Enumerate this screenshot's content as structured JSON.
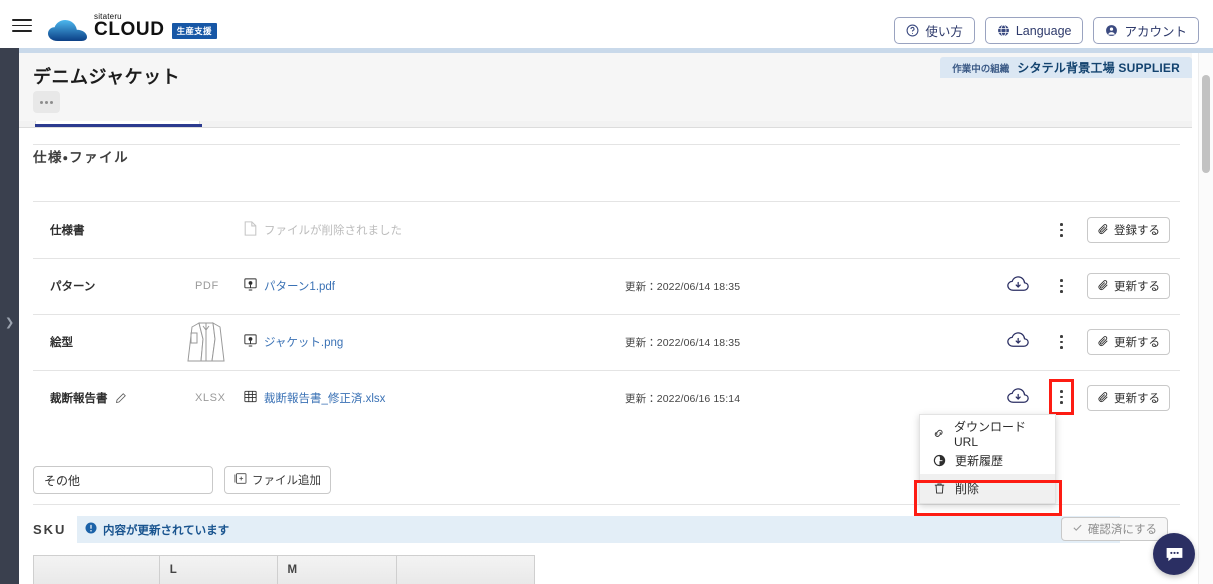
{
  "header": {
    "menu_icon": "hamburger-icon",
    "brand_sub": "sitateru",
    "brand_main": "CLOUD",
    "brand_badge": "生産支援",
    "actions": [
      {
        "label": "使い方",
        "icon": "help-circle-icon"
      },
      {
        "label": "Language",
        "icon": "globe-icon"
      },
      {
        "label": "アカウント",
        "icon": "account-circle-icon"
      }
    ]
  },
  "page": {
    "title": "デニムジャケット",
    "more_button": "…",
    "org_label": "作業中の組織",
    "org_name": "シタテル背景工場 SUPPLIER"
  },
  "section": {
    "title": "仕様・ファイル"
  },
  "files": {
    "rows": [
      {
        "label": "仕様書",
        "type": "",
        "file_name": "ファイルが削除されました",
        "file_state": "removed",
        "file_icon": "blank-file-icon",
        "date": "",
        "has_cloud": false,
        "has_kebab": true,
        "kebab_highlight": false,
        "thumb": "",
        "action_label": "登録する",
        "action_icon": "paperclip-icon",
        "editable": false
      },
      {
        "label": "パターン",
        "type": "PDF",
        "file_name": "パターン1.pdf",
        "file_state": "link",
        "file_icon": "image-file-icon",
        "date": "更新：2022/06/14 18:35",
        "has_cloud": true,
        "has_kebab": true,
        "kebab_highlight": false,
        "thumb": "",
        "action_label": "更新する",
        "action_icon": "paperclip-icon",
        "editable": false
      },
      {
        "label": "絵型",
        "type": "",
        "file_name": "ジャケット.png",
        "file_state": "link",
        "file_icon": "image-file-icon",
        "date": "更新：2022/06/14 18:35",
        "has_cloud": true,
        "has_kebab": true,
        "kebab_highlight": false,
        "thumb": "jacket-sketch-thumbnail",
        "action_label": "更新する",
        "action_icon": "paperclip-icon",
        "editable": false
      },
      {
        "label": "裁断報告書",
        "type": "XLSX",
        "file_name": "裁断報告書_修正済.xlsx",
        "file_state": "link",
        "file_icon": "spreadsheet-file-icon",
        "date": "更新：2022/06/16 15:14",
        "has_cloud": true,
        "has_kebab": true,
        "kebab_highlight": true,
        "thumb": "",
        "action_label": "更新する",
        "action_icon": "paperclip-icon",
        "editable": true
      }
    ],
    "other_input_value": "その他",
    "other_input_placeholder": "その他",
    "add_file_label": "ファイル追加",
    "add_file_icon": "add-image-icon"
  },
  "context_menu": {
    "items": [
      {
        "label": "ダウンロードURL",
        "icon": "link-icon",
        "highlighted": false
      },
      {
        "label": "更新履歴",
        "icon": "history-icon",
        "highlighted": false
      },
      {
        "label": "削除",
        "icon": "trash-icon",
        "highlighted": true
      }
    ]
  },
  "sku": {
    "label": "SKU",
    "alert_text": "内容が更新されています",
    "alert_icon": "info-icon",
    "confirm_label": "確認済にする",
    "confirm_icon": "check-icon",
    "table_headers": [
      "",
      "L",
      "M",
      ""
    ]
  },
  "chat": {
    "icon": "chat-bubble-icon"
  },
  "colors": {
    "accent": "#2b3a8f",
    "link": "#3b72b5",
    "highlight": "#fd1c13",
    "brand_badge": "#1757a6",
    "alert_bg": "#e3eef7",
    "rail": "#3a404e"
  }
}
